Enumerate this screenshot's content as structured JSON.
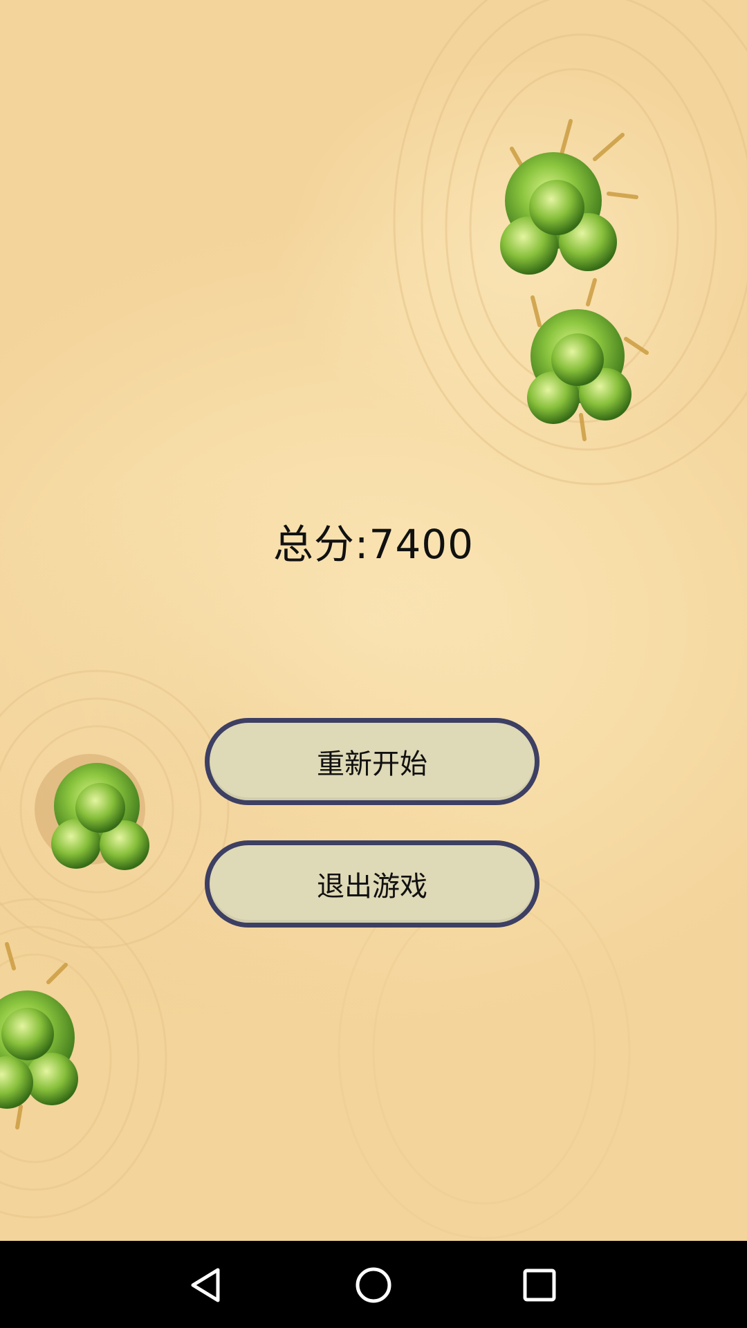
{
  "game": {
    "score_text": "总分:7400",
    "buttons": {
      "restart": "重新开始",
      "exit": "退出游戏"
    },
    "background": {
      "sand_color": "#f7e2b0",
      "bush_color": "#5f9a2a",
      "bushes": [
        "bush-icon",
        "bush-icon",
        "bush-icon",
        "bush-icon"
      ]
    },
    "button_colors": {
      "fill": "#ded9b6",
      "border": "#3d3f63"
    }
  },
  "system_nav": {
    "back": "back-icon",
    "home": "home-icon",
    "recents": "recents-icon"
  }
}
